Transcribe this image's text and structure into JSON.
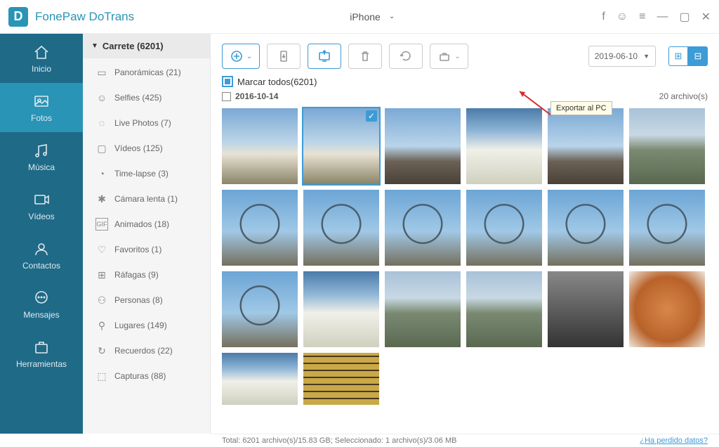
{
  "app_title": "FonePaw DoTrans",
  "device": {
    "name": "iPhone"
  },
  "sidebar": {
    "items": [
      {
        "label": "Inicio"
      },
      {
        "label": "Fotos"
      },
      {
        "label": "Música"
      },
      {
        "label": "Vídeos"
      },
      {
        "label": "Contactos"
      },
      {
        "label": "Mensajes"
      },
      {
        "label": "Herramientas"
      }
    ]
  },
  "album": {
    "header": "Carrete (6201)",
    "categories": [
      {
        "label": "Panorámicas (21)"
      },
      {
        "label": "Selfies (425)"
      },
      {
        "label": "Live Photos (7)"
      },
      {
        "label": "Vídeos (125)"
      },
      {
        "label": "Time-lapse (3)"
      },
      {
        "label": "Cámara lenta (1)"
      },
      {
        "label": "Animados (18)"
      },
      {
        "label": "Favoritos (1)"
      },
      {
        "label": "Ráfagas (9)"
      },
      {
        "label": "Personas (8)"
      },
      {
        "label": "Lugares (149)"
      },
      {
        "label": "Recuerdos (22)"
      },
      {
        "label": "Capturas (88)"
      }
    ]
  },
  "toolbar": {
    "export_tooltip": "Exportar al PC",
    "date": "2019-06-10"
  },
  "select_all": "Marcar todos(6201)",
  "group": {
    "date": "2016-10-14",
    "count": "20 archivo(s)"
  },
  "status": {
    "text": "Total: 6201 archivo(s)/15.83 GB; Seleccionado: 1 archivo(s)/3.06 MB",
    "lost_link": "¿Ha perdido datos?"
  }
}
